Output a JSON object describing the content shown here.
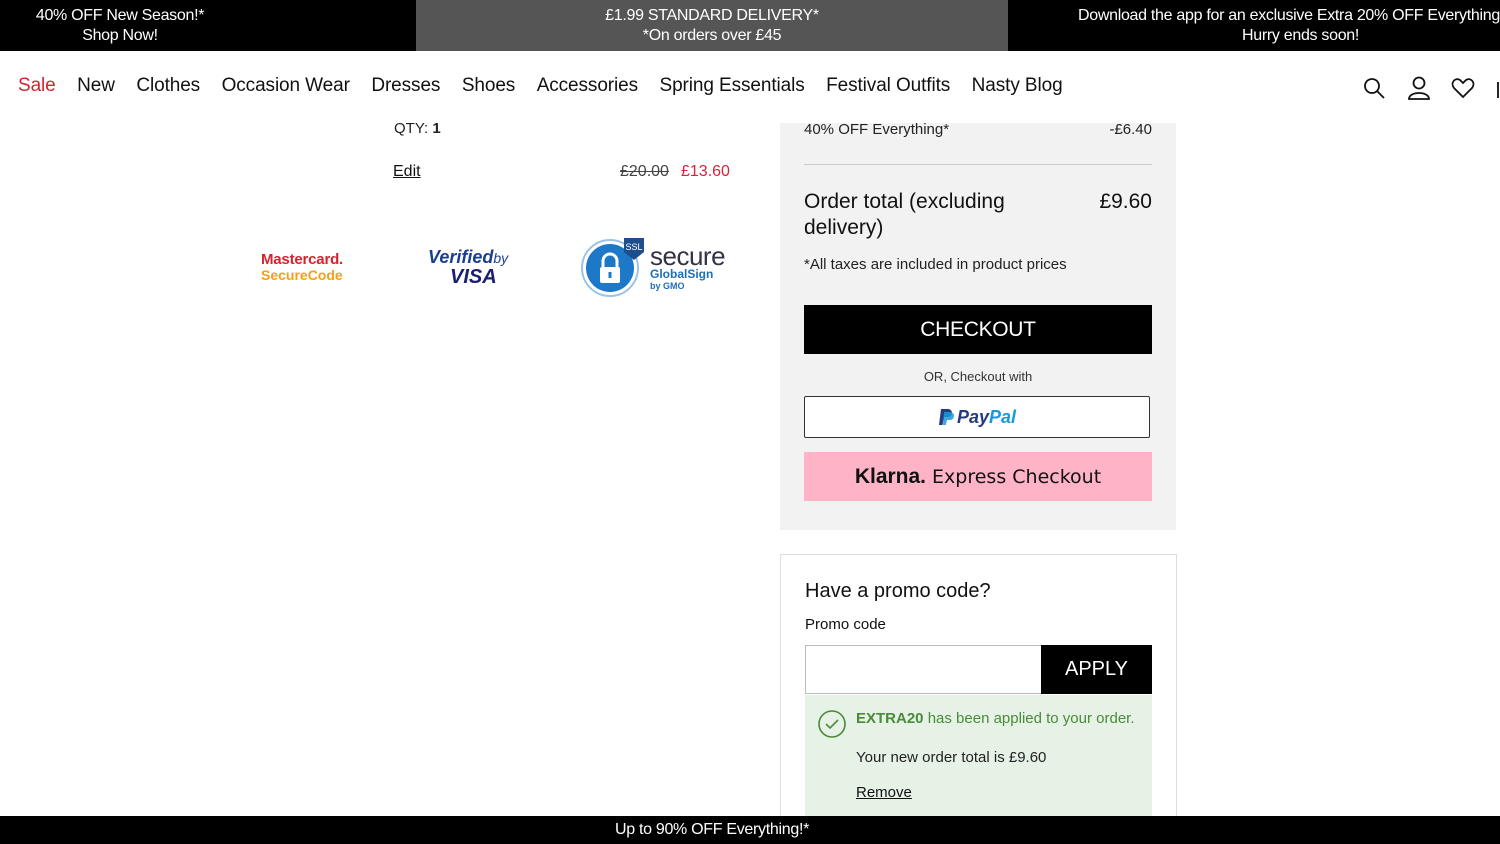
{
  "promo_strip": {
    "left": {
      "line1": "40% OFF New Season!*",
      "line2": "Shop Now!"
    },
    "center": {
      "line1": "£1.99 STANDARD DELIVERY*",
      "line2": "*On orders over £45"
    },
    "right": {
      "line1": "Download the app for an exclusive Extra 20% OFF Everything",
      "line2": "Hurry ends soon!"
    }
  },
  "nav": {
    "items": [
      "Sale",
      "New",
      "Clothes",
      "Occasion Wear",
      "Dresses",
      "Shoes",
      "Accessories",
      "Spring Essentials",
      "Festival Outfits",
      "Nasty Blog"
    ],
    "icons": [
      "search-icon",
      "account-icon",
      "wishlist-heart-icon",
      "bag-icon"
    ],
    "accent_color": "#d6232e"
  },
  "product": {
    "qty_label": "QTY:",
    "qty_value": "1",
    "edit_label": "Edit",
    "price_old": "£20.00",
    "price_new": "£13.60"
  },
  "trust_badges": {
    "mastercard": {
      "line1": "Mastercard.",
      "line2": "SecureCode"
    },
    "visa": {
      "line1": "Verified",
      "by": "by",
      "line2": "VISA"
    },
    "ssl": {
      "badge": "SSL",
      "line1": "secure",
      "line2": "GlobalSign",
      "line3": "by GMO"
    }
  },
  "summary": {
    "discount_label": "40% OFF Everything*",
    "discount_value": "-£6.40",
    "order_total_label": "Order total (excluding delivery)",
    "order_total_value": "£9.60",
    "tax_note": "*All taxes are included in product prices",
    "checkout_label": "CHECKOUT",
    "or_text": "OR, Checkout with",
    "paypal": {
      "part1": "Pay",
      "part2": "Pal"
    },
    "klarna": {
      "brand": "Klarna.",
      "label": "Express Checkout"
    }
  },
  "promo": {
    "title": "Have a promo code?",
    "label": "Promo code",
    "input_value": "",
    "apply_label": "APPLY",
    "success": {
      "code": "EXTRA20",
      "message": " has been applied to your order.",
      "total_line": "Your new order total is £9.60",
      "remove_label": "Remove"
    }
  },
  "bottom_bar": {
    "text": "Up to 90% OFF Everything!*"
  }
}
